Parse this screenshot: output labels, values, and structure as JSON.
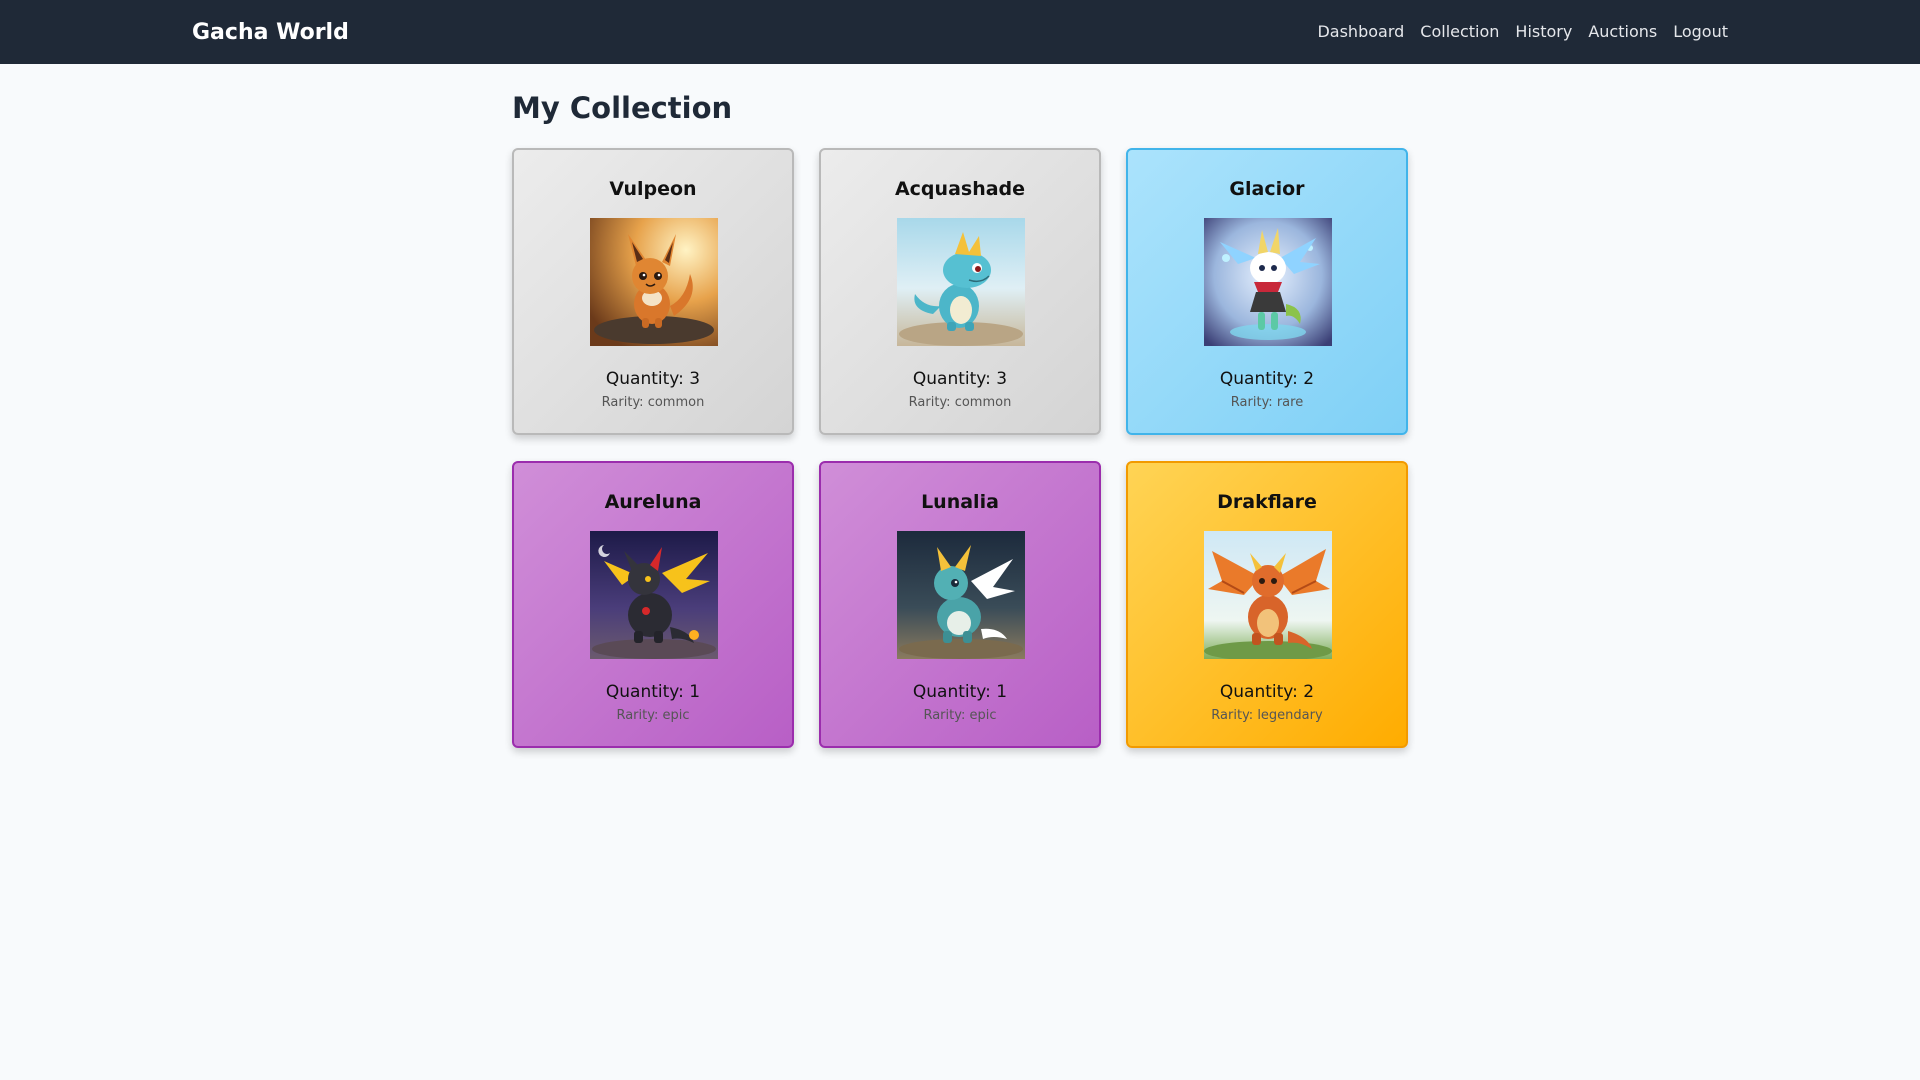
{
  "navbar": {
    "brand": "Gacha World",
    "links": [
      {
        "label": "Dashboard"
      },
      {
        "label": "Collection"
      },
      {
        "label": "History"
      },
      {
        "label": "Auctions"
      },
      {
        "label": "Logout"
      }
    ]
  },
  "page": {
    "title": "My Collection"
  },
  "collection": [
    {
      "name": "Vulpeon",
      "quantity": "Quantity: 3",
      "rarity": "Rarity: common",
      "image_icon": "fox-creature-icon"
    },
    {
      "name": "Acquashade",
      "quantity": "Quantity: 3",
      "rarity": "Rarity: common",
      "image_icon": "water-dino-creature-icon"
    },
    {
      "name": "Glacior",
      "quantity": "Quantity: 2",
      "rarity": "Rarity: rare",
      "image_icon": "ice-sprite-creature-icon"
    },
    {
      "name": "Aureluna",
      "quantity": "Quantity: 1",
      "rarity": "Rarity: epic",
      "image_icon": "dark-dragon-creature-icon"
    },
    {
      "name": "Lunalia",
      "quantity": "Quantity: 1",
      "rarity": "Rarity: epic",
      "image_icon": "teal-dragon-creature-icon"
    },
    {
      "name": "Drakflare",
      "quantity": "Quantity: 2",
      "rarity": "Rarity: legendary",
      "image_icon": "fire-dragon-creature-icon"
    }
  ],
  "colors": {
    "navbar_bg": "#1f2937",
    "page_bg": "#f8fafc",
    "common": "#d4d4d4",
    "rare": "#7fd0f6",
    "epic": "#b85fc6",
    "legendary": "#ffac00"
  }
}
